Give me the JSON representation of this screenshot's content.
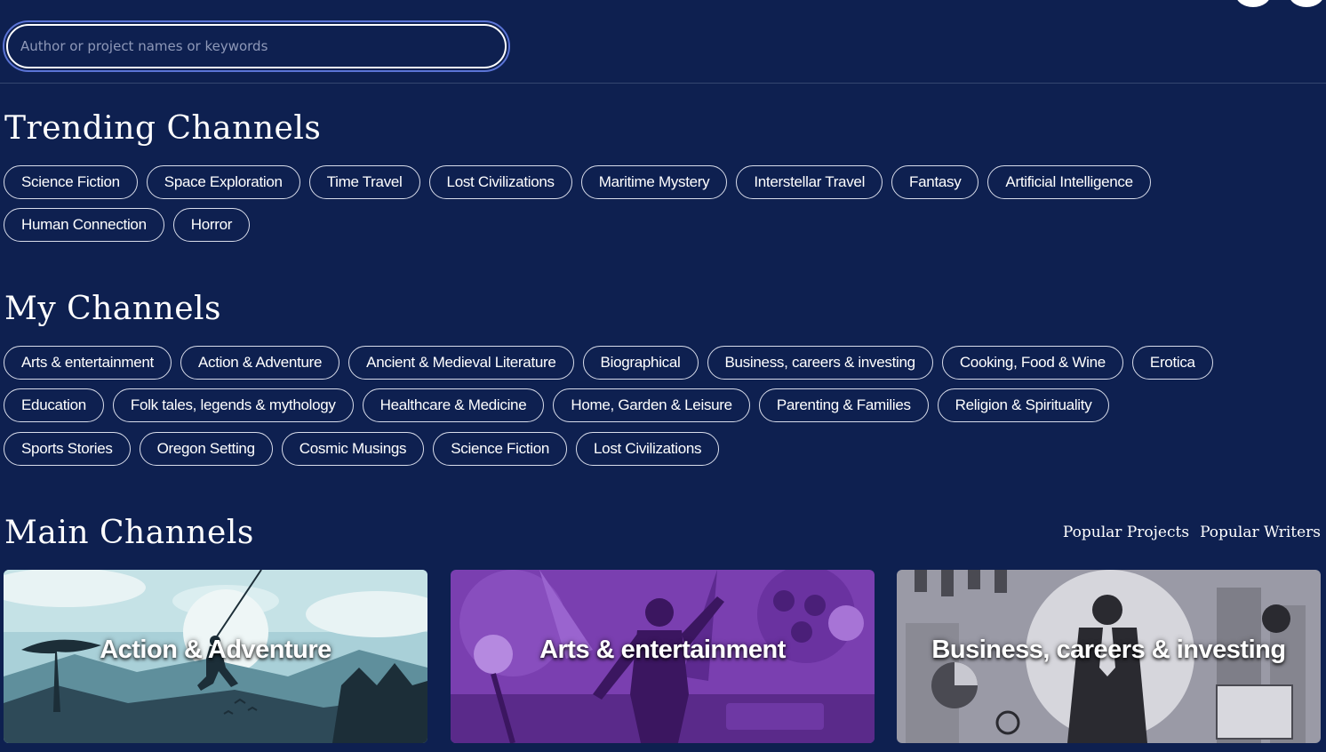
{
  "search": {
    "placeholder": "Author or project names or keywords"
  },
  "trending": {
    "title": "Trending Channels",
    "row1": [
      "Science Fiction",
      "Space Exploration",
      "Time Travel",
      "Lost Civilizations",
      "Maritime Mystery",
      "Interstellar Travel",
      "Fantasy",
      "Artificial Intelligence"
    ],
    "row2": [
      "Human Connection",
      "Horror"
    ]
  },
  "my_channels": {
    "title": "My Channels",
    "row1": [
      "Arts & entertainment",
      "Action & Adventure",
      "Ancient & Medieval Literature",
      "Biographical",
      "Business, careers & investing",
      "Cooking, Food & Wine",
      "Erotica"
    ],
    "row2": [
      "Education",
      "Folk tales, legends & mythology",
      "Healthcare & Medicine",
      "Home, Garden & Leisure",
      "Parenting & Families",
      "Religion & Spirituality"
    ],
    "row3": [
      "Sports Stories",
      "Oregon Setting",
      "Cosmic Musings",
      "Science Fiction",
      "Lost Civilizations"
    ]
  },
  "main_channels": {
    "title": "Main Channels",
    "popular_projects": "Popular Projects",
    "popular_writers": "Popular Writers",
    "cards": [
      "Action & Adventure",
      "Arts & entertainment",
      "Business, careers & investing"
    ]
  },
  "colors": {
    "background": "#0e2050",
    "chip_border": "#d8dcea",
    "search_focus_ring": "#5b74d6",
    "card_adventure": "#7fb6c4",
    "card_arts": "#7a3fb0",
    "card_business": "#9a9aa6"
  },
  "icons": [
    "user-avatar-icon",
    "menu-icon"
  ]
}
